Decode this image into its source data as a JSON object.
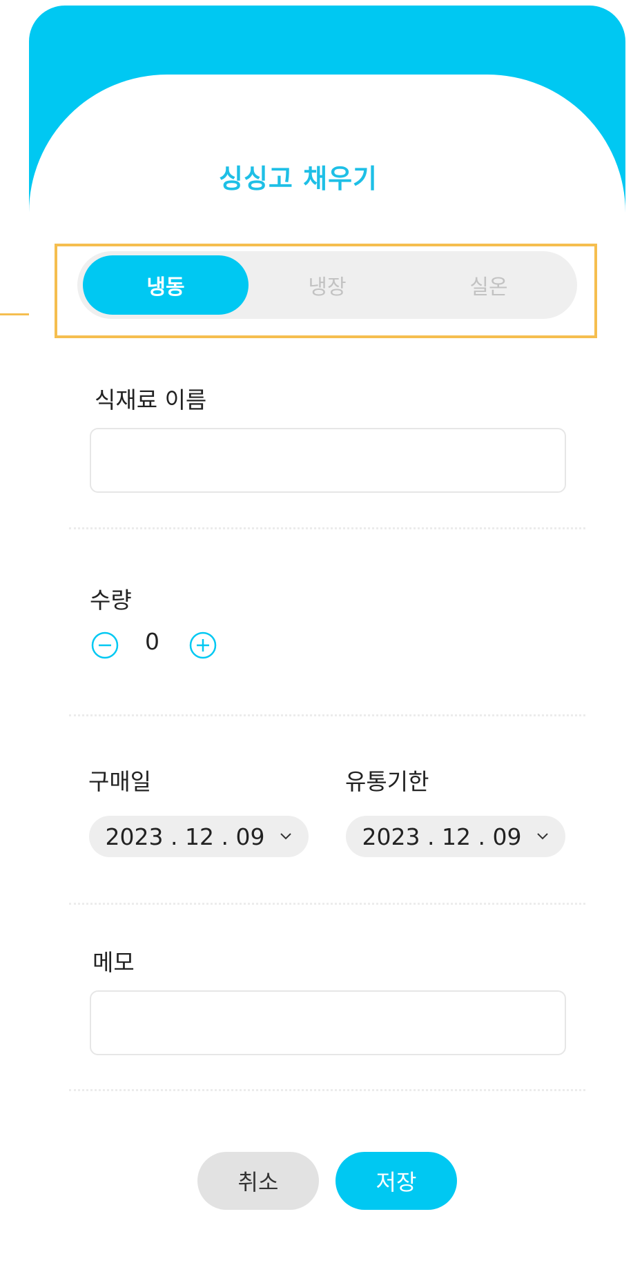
{
  "title": "싱싱고 채우기",
  "storage_tabs": [
    {
      "label": "냉동",
      "active": true
    },
    {
      "label": "냉장",
      "active": false
    },
    {
      "label": "실온",
      "active": false
    }
  ],
  "ingredient_name": {
    "label": "식재료 이름",
    "value": ""
  },
  "quantity": {
    "label": "수량",
    "value": "0"
  },
  "purchase_date": {
    "label": "구매일",
    "value": "2023 . 12 . 09"
  },
  "expiry_date": {
    "label": "유통기한",
    "value": "2023 . 12 . 09"
  },
  "memo": {
    "label": "메모",
    "value": ""
  },
  "buttons": {
    "cancel": "취소",
    "save": "저장"
  },
  "icons": {
    "decrement": "minus-circle-icon",
    "increment": "plus-circle-icon",
    "dropdown": "chevron-down-icon"
  },
  "colors": {
    "accent": "#00c8f2",
    "title": "#1ebfe6",
    "highlight": "#f5be4f",
    "pill_bg": "#eeeeee"
  }
}
